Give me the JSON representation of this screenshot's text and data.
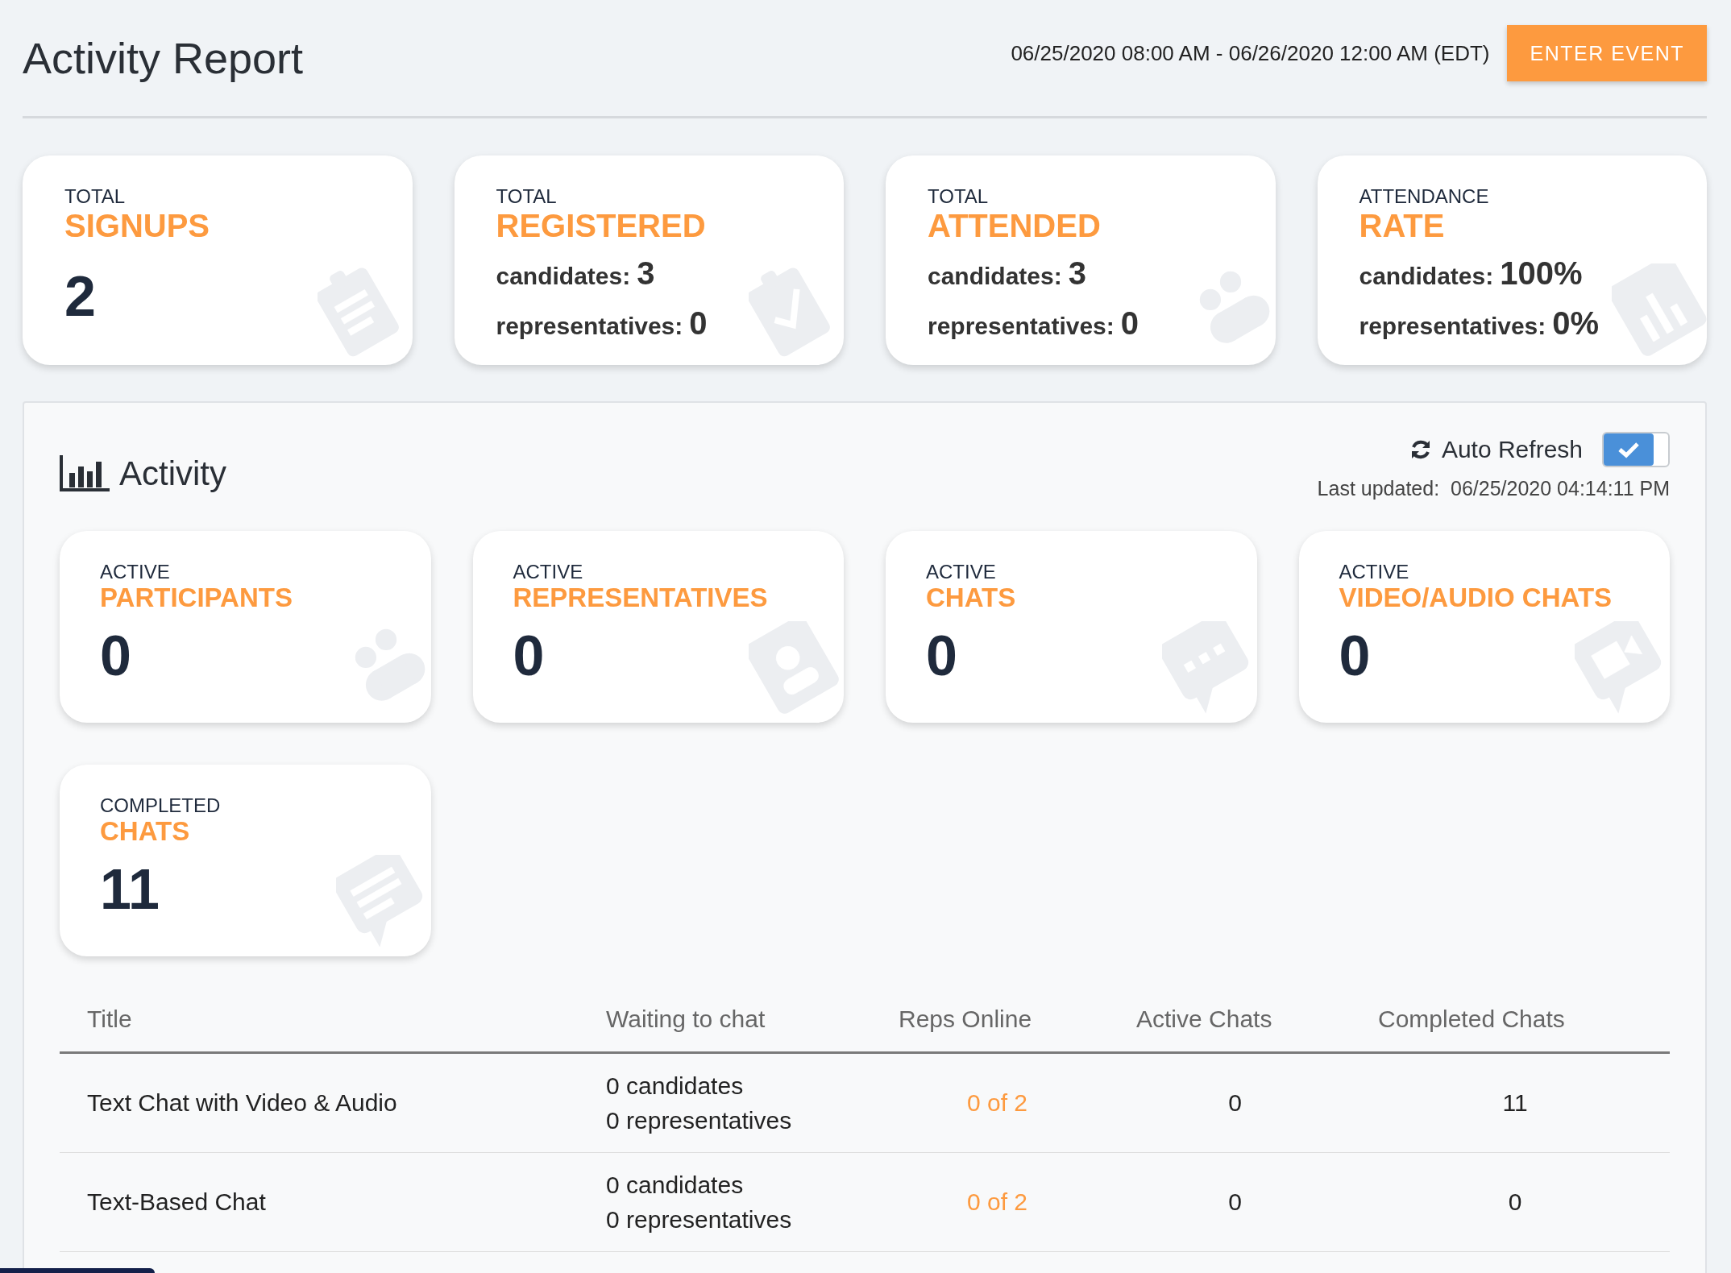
{
  "header": {
    "title": "Activity Report",
    "date_range": "06/25/2020 08:00 AM - 06/26/2020 12:00 AM (EDT)",
    "button": "ENTER EVENT"
  },
  "summary_cards": [
    {
      "kind": "single",
      "caption": "TOTAL",
      "title": "SIGNUPS",
      "value": "2"
    },
    {
      "kind": "split",
      "caption": "TOTAL",
      "title": "REGISTERED",
      "lines": [
        {
          "label": "candidates:",
          "value": "3"
        },
        {
          "label": "representatives:",
          "value": "0"
        }
      ]
    },
    {
      "kind": "split",
      "caption": "TOTAL",
      "title": "ATTENDED",
      "lines": [
        {
          "label": "candidates:",
          "value": "3"
        },
        {
          "label": "representatives:",
          "value": "0"
        }
      ]
    },
    {
      "kind": "split",
      "caption": "ATTENDANCE",
      "title": "RATE",
      "lines": [
        {
          "label": "candidates:",
          "value": "100%"
        },
        {
          "label": "representatives:",
          "value": "0%"
        }
      ]
    }
  ],
  "activity": {
    "title": "Activity",
    "auto_refresh": {
      "label": "Auto Refresh",
      "checked": true
    },
    "last_updated": {
      "label": "Last updated:",
      "value": "06/25/2020 04:14:11 PM"
    },
    "cards": [
      {
        "caption": "ACTIVE",
        "title": "PARTICIPANTS",
        "value": "0"
      },
      {
        "caption": "ACTIVE",
        "title": "REPRESENTATIVES",
        "value": "0"
      },
      {
        "caption": "ACTIVE",
        "title": "CHATS",
        "value": "0"
      },
      {
        "caption": "ACTIVE",
        "title": "VIDEO/AUDIO CHATS",
        "value": "0"
      },
      {
        "caption": "COMPLETED",
        "title": "CHATS",
        "value": "11"
      }
    ],
    "table": {
      "columns": [
        "Title",
        "Waiting to chat",
        "Reps Online",
        "Active Chats",
        "Completed Chats"
      ],
      "rows": [
        {
          "title": "Text Chat with Video & Audio",
          "waiting": [
            "0 candidates",
            "0 representatives"
          ],
          "reps_online": "0 of 2",
          "active_chats": "0",
          "completed_chats": "11"
        },
        {
          "title": "Text-Based Chat",
          "waiting": [
            "0 candidates",
            "0 representatives"
          ],
          "reps_online": "0 of 2",
          "active_chats": "0",
          "completed_chats": "0"
        }
      ]
    }
  }
}
